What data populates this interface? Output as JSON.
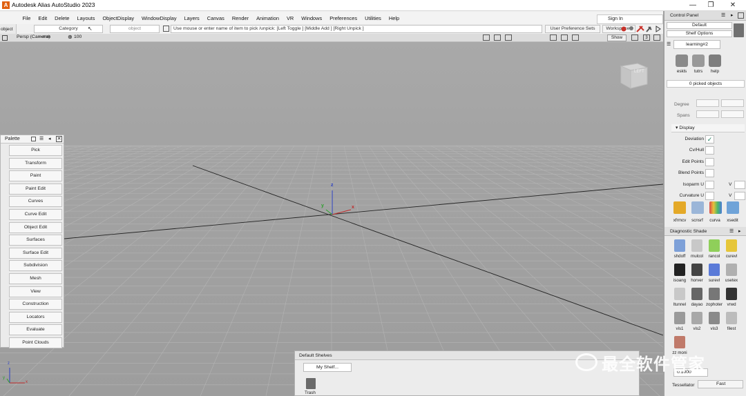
{
  "window": {
    "title": "Autodesk Alias AutoStudio 2023",
    "minimize": "—",
    "maximize": "❐",
    "close": "✕"
  },
  "menu": [
    "File",
    "Edit",
    "Delete",
    "Layouts",
    "ObjectDisplay",
    "WindowDisplay",
    "Layers",
    "Canvas",
    "Render",
    "Animation",
    "VR",
    "Windows",
    "Preferences",
    "Utilities",
    "Help"
  ],
  "signin": "Sign In",
  "object_tool": {
    "label": "object",
    "icon": "object-tool-icon"
  },
  "row2": {
    "category": "Category",
    "object": "object",
    "prompt": "Use mouse or enter name of item to pick /unpick: [Left Toggle ] [Middle Add ] [Right Unpick ]",
    "user_pref_sets": "User Preference Sets",
    "workspaces": "Workspaces"
  },
  "viewport": {
    "camera": "Persp (Camera)",
    "units": "—mm",
    "zoom": "100",
    "show_label": "Show",
    "viewcube_label": "LEFT",
    "grid_view_count": "3"
  },
  "axes": {
    "x": "x",
    "y": "y",
    "z": "z"
  },
  "palette": {
    "title": "Palette",
    "items": [
      "Pick",
      "Transform",
      "Paint",
      "Paint Edit",
      "Curves",
      "Curve Edit",
      "Object Edit",
      "Surfaces",
      "Surface Edit",
      "Subdivision",
      "Mesh",
      "View",
      "Construction",
      "Locators",
      "Evaluate",
      "Point Clouds"
    ]
  },
  "shelves": {
    "title": "Default Shelves",
    "tab": "My Shelf...",
    "trash_label": "Trash"
  },
  "control_panel": {
    "title": "Control Panel",
    "preset": "Default",
    "shelf_options": "Shelf Options",
    "shelf_tab": "learning#2",
    "shelf_items": [
      "eskls",
      "tutrs",
      "help"
    ],
    "picked": "0 picked objects",
    "degree_label": "Degree",
    "spans_label": "Spans",
    "display_section": "Display",
    "display_rows": [
      {
        "label": "Deviation",
        "checked": "✓"
      },
      {
        "label": "Cv/Hull",
        "checked": ""
      },
      {
        "label": "Edit Points",
        "checked": ""
      },
      {
        "label": "Blend Points",
        "checked": ""
      },
      {
        "label": "Isoparm U",
        "checked": ""
      },
      {
        "label": "Curvature U",
        "checked": ""
      }
    ],
    "v_label": "V",
    "tool_items": [
      "xfrmcv",
      "scnsrf",
      "curva",
      "xsedit"
    ],
    "diag_title": "Diagnostic Shade",
    "diag_items": [
      "shdoff",
      "mulcol",
      "rancol",
      "curevl",
      "isoang",
      "horver",
      "surevl",
      "usetex",
      "ltunnel",
      "dayao",
      "zophoter",
      "vrwd",
      "vis1",
      "vis2",
      "vis3",
      "filest",
      "zz moni"
    ],
    "numeric_value": "0.1000",
    "tessellator_label": "Tessellator",
    "tessellator_value": "Fast"
  },
  "watermark": {
    "text": "最全软件管家"
  }
}
